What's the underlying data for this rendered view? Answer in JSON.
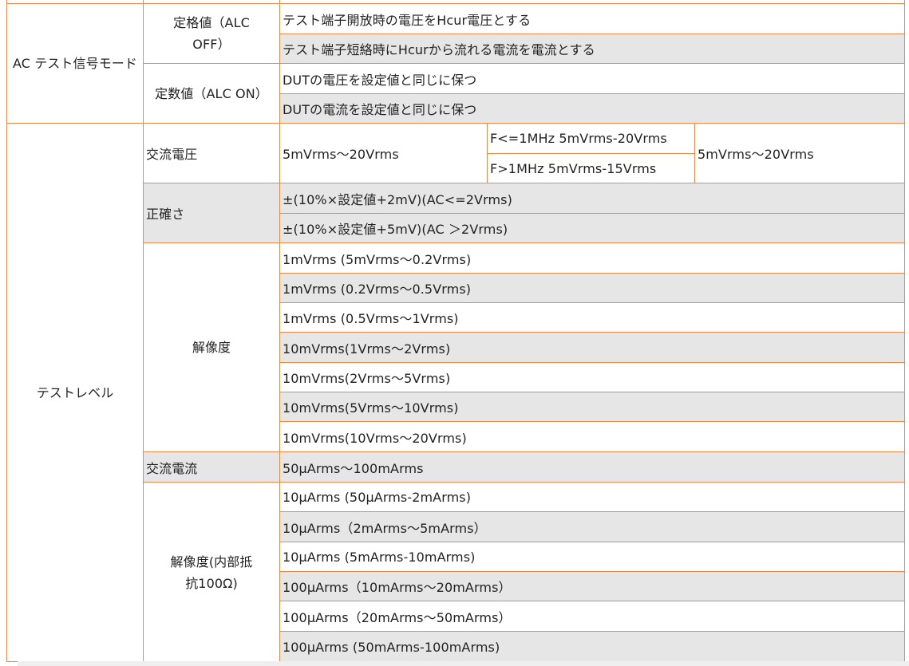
{
  "ac_mode": {
    "header": "AC テスト信号モード",
    "rated": {
      "label": "定格値（ALC OFF）",
      "desc": [
        "テスト端子開放時の電圧をHcur電圧とする",
        "テスト端子短絡時にHcurから流れる電流を電流とする"
      ]
    },
    "constant": {
      "label": "定数値（ALC ON）",
      "desc": [
        "DUTの電圧を設定値と同じに保つ",
        "DUTの電流を設定値と同じに保つ"
      ]
    }
  },
  "test_level": {
    "header": "テストレベル",
    "ac_voltage": {
      "label": "交流電圧",
      "range1": "5mVrms～20Vrms",
      "freq": [
        "F<=1MHz 5mVrms-20Vrms",
        "F>1MHz 5mVrms-15Vrms"
      ],
      "range2": "5mVrms～20Vrms"
    },
    "accuracy": {
      "label": "正確さ",
      "values": [
        "±(10%×設定値+2mV)(AC<=2Vrms)",
        "±(10%×設定値+5mV)(AC ＞2Vrms)"
      ]
    },
    "resolution": {
      "label": "解像度",
      "values": [
        "1mVrms (5mVrms～0.2Vrms)",
        "1mVrms (0.2Vrms～0.5Vrms)",
        "1mVrms (0.5Vrms～1Vrms)",
        "10mVrms(1Vrms～2Vrms)",
        "10mVrms(2Vrms～5Vrms)",
        "10mVrms(5Vrms～10Vrms)",
        "10mVrms(10Vrms～20Vrms)"
      ]
    },
    "ac_current": {
      "label": "交流電流",
      "value": "50μArms～100mArms"
    },
    "current_resolution": {
      "label": "解像度(内部抵抗100Ω)",
      "values": [
        "10μArms (50μArms-2mArms)",
        "10μArms（2mArms～5mArms）",
        "10μArms (5mArms-10mArms)",
        "100μArms（10mArms～20mArms）",
        "100μArms（20mArms～50mArms）",
        "100μArms (50mArms-100mArms)"
      ]
    }
  }
}
